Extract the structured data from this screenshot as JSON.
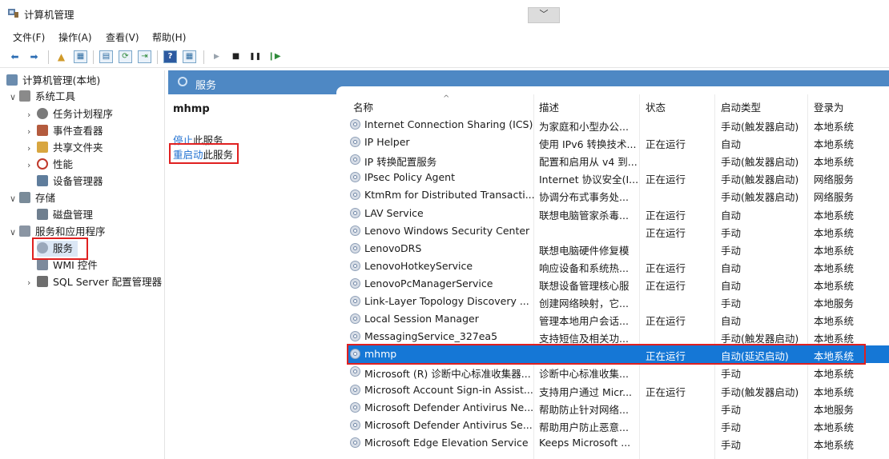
{
  "window": {
    "title": "计算机管理",
    "collapse_glyph": "﹀"
  },
  "menu": [
    "文件(F)",
    "操作(A)",
    "查看(V)",
    "帮助(H)"
  ],
  "toolbar": {
    "icons": [
      "back-arrow-icon",
      "forward-arrow-icon",
      "up-folder-icon",
      "console-tree-icon",
      "properties-icon",
      "refresh-icon",
      "export-icon",
      "help-icon",
      "view-icon",
      "start-icon",
      "stop-icon",
      "pause-icon",
      "restart-icon"
    ],
    "glyphs": [
      "⬅",
      "➡",
      "▲",
      "▦",
      "▤",
      "⟳",
      "⇥",
      "?",
      "▦",
      "▶",
      "■",
      "❚❚",
      "❙▶"
    ]
  },
  "tree": [
    {
      "label": "计算机管理(本地)",
      "chev": "",
      "depth": 0,
      "color": "#6b8cae"
    },
    {
      "label": "系统工具",
      "chev": "∨",
      "depth": 1,
      "color": "#8a8a8a"
    },
    {
      "label": "任务计划程序",
      "chev": "›",
      "depth": 2,
      "color": "#7a7a7a"
    },
    {
      "label": "事件查看器",
      "chev": "›",
      "depth": 2,
      "color": "#b45b3e"
    },
    {
      "label": "共享文件夹",
      "chev": "›",
      "depth": 2,
      "color": "#d8a640"
    },
    {
      "label": "性能",
      "chev": "›",
      "depth": 2,
      "color": "#c0392b"
    },
    {
      "label": "设备管理器",
      "chev": "",
      "depth": 2,
      "color": "#5f7d9c"
    },
    {
      "label": "存储",
      "chev": "∨",
      "depth": 1,
      "color": "#7a8b99"
    },
    {
      "label": "磁盘管理",
      "chev": "",
      "depth": 2,
      "color": "#6f7f8f"
    },
    {
      "label": "服务和应用程序",
      "chev": "∨",
      "depth": 1,
      "color": "#8a95a3"
    },
    {
      "label": "服务",
      "chev": "",
      "depth": 2,
      "color": "#9aa8bb",
      "selected": true
    },
    {
      "label": "WMI 控件",
      "chev": "",
      "depth": 2,
      "color": "#7c8a9c"
    },
    {
      "label": "SQL Server 配置管理器",
      "chev": "›",
      "depth": 2,
      "color": "#6e6e6e"
    }
  ],
  "header": {
    "title": "服务"
  },
  "detail": {
    "service_name": "mhmp",
    "stop_link": "停止",
    "stop_text": "此服务",
    "restart_link": "重启动",
    "restart_text": "此服务"
  },
  "columns": {
    "name": "名称",
    "desc": "描述",
    "status": "状态",
    "startup": "启动类型",
    "logon": "登录为",
    "sort_glyph": "^"
  },
  "services": [
    {
      "name": "Internet Connection Sharing (ICS)",
      "desc": "为家庭和小型办公...",
      "status": "",
      "startup": "手动(触发器启动)",
      "logon": "本地系统"
    },
    {
      "name": "IP Helper",
      "desc": "使用 IPv6 转换技术...",
      "status": "正在运行",
      "startup": "自动",
      "logon": "本地系统"
    },
    {
      "name": "IP 转换配置服务",
      "desc": "配置和启用从 v4 到...",
      "status": "",
      "startup": "手动(触发器启动)",
      "logon": "本地系统"
    },
    {
      "name": "IPsec Policy Agent",
      "desc": "Internet 协议安全(I...",
      "status": "正在运行",
      "startup": "手动(触发器启动)",
      "logon": "网络服务"
    },
    {
      "name": "KtmRm for Distributed Transacti...",
      "desc": "协调分布式事务处...",
      "status": "",
      "startup": "手动(触发器启动)",
      "logon": "网络服务"
    },
    {
      "name": "LAV Service",
      "desc": "联想电脑管家杀毒...",
      "status": "正在运行",
      "startup": "自动",
      "logon": "本地系统"
    },
    {
      "name": "Lenovo Windows Security Center",
      "desc": "",
      "status": "正在运行",
      "startup": "手动",
      "logon": "本地系统"
    },
    {
      "name": "LenovoDRS",
      "desc": "联想电脑硬件修复模",
      "status": "",
      "startup": "手动",
      "logon": "本地系统"
    },
    {
      "name": "LenovoHotkeyService",
      "desc": "响应设备和系统热...",
      "status": "正在运行",
      "startup": "自动",
      "logon": "本地系统"
    },
    {
      "name": "LenovoPcManagerService",
      "desc": "联想设备管理核心服",
      "status": "正在运行",
      "startup": "自动",
      "logon": "本地系统"
    },
    {
      "name": "Link-Layer Topology Discovery ...",
      "desc": "创建网络映射，它...",
      "status": "",
      "startup": "手动",
      "logon": "本地服务"
    },
    {
      "name": "Local Session Manager",
      "desc": "管理本地用户会话...",
      "status": "正在运行",
      "startup": "自动",
      "logon": "本地系统"
    },
    {
      "name": "MessagingService_327ea5",
      "desc": "支持短信及相关功...",
      "status": "",
      "startup": "手动(触发器启动)",
      "logon": "本地系统"
    },
    {
      "name": "mhmp",
      "desc": "",
      "status": "正在运行",
      "startup": "自动(延迟启动)",
      "logon": "本地系统",
      "selected": true
    },
    {
      "name": "Microsoft (R) 诊断中心标准收集器...",
      "desc": "诊断中心标准收集...",
      "status": "",
      "startup": "手动",
      "logon": "本地系统"
    },
    {
      "name": "Microsoft Account Sign-in Assist...",
      "desc": "支持用户通过 Micr...",
      "status": "正在运行",
      "startup": "手动(触发器启动)",
      "logon": "本地系统"
    },
    {
      "name": "Microsoft Defender Antivirus Ne...",
      "desc": "帮助防止针对网络...",
      "status": "",
      "startup": "手动",
      "logon": "本地服务"
    },
    {
      "name": "Microsoft Defender Antivirus Se...",
      "desc": "帮助用户防止恶意...",
      "status": "",
      "startup": "手动",
      "logon": "本地系统"
    },
    {
      "name": "Microsoft Edge Elevation Service",
      "desc": "Keeps Microsoft ...",
      "status": "",
      "startup": "手动",
      "logon": "本地系统"
    }
  ],
  "colors": {
    "header_bar": "#4e88c4",
    "selection": "#1577d6",
    "highlight_outline": "#e02020",
    "link": "#1e6fd0"
  }
}
